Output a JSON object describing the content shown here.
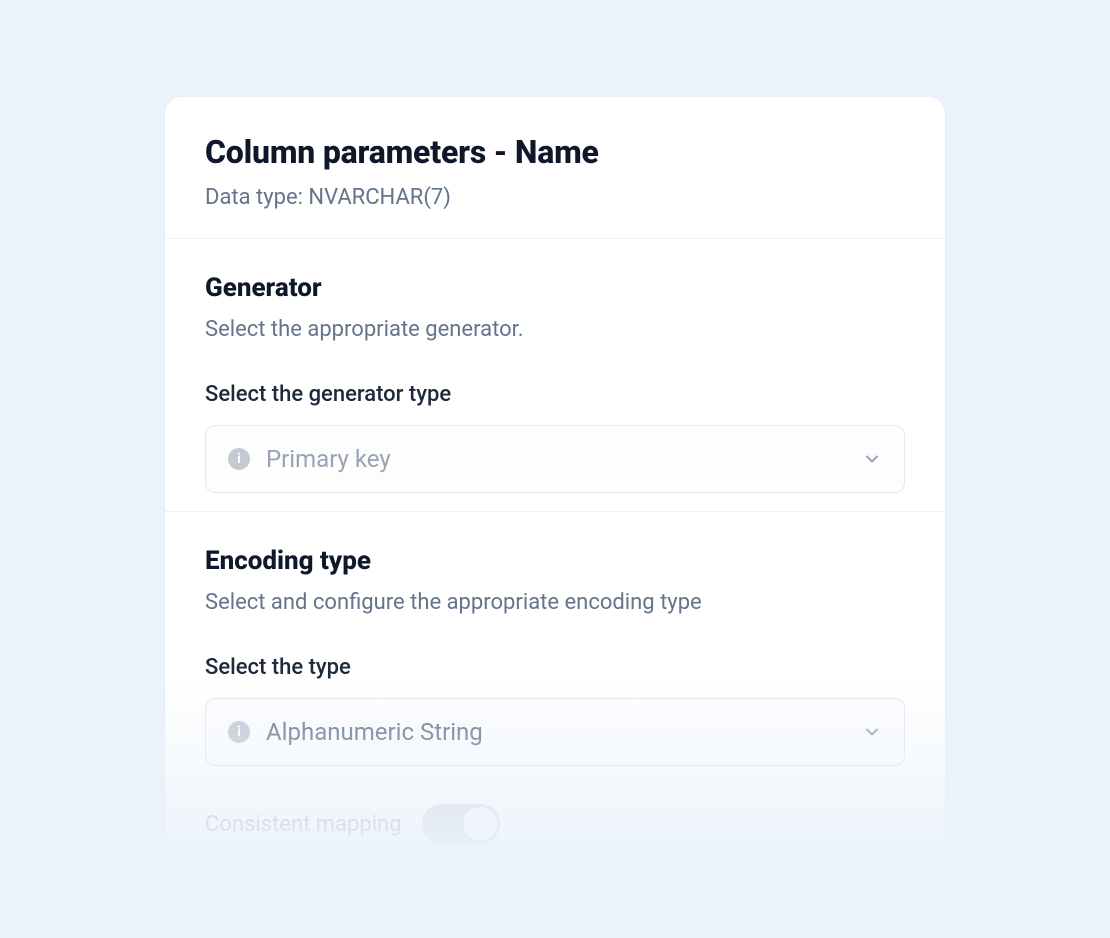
{
  "header": {
    "title": "Column parameters - Name",
    "subtitle": "Data type: NVARCHAR(7)"
  },
  "generator": {
    "section_title": "Generator",
    "section_desc": "Select the appropriate generator.",
    "field_label": "Select the generator type",
    "select_value": "Primary key"
  },
  "encoding": {
    "section_title": "Encoding type",
    "section_desc": "Select and configure the appropriate encoding type",
    "field_label": "Select the type",
    "select_value": "Alphanumeric String"
  },
  "consistent_mapping": {
    "label": "Consistent mapping",
    "enabled": false
  }
}
